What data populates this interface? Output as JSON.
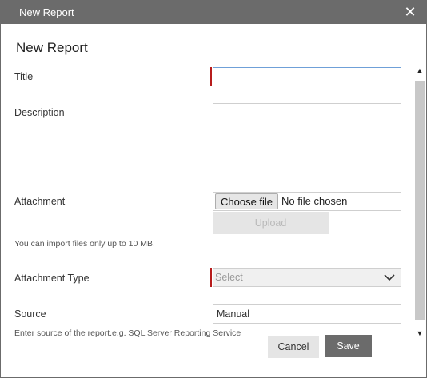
{
  "dialog": {
    "title": "New Report",
    "close_glyph": "✕",
    "heading": "New Report"
  },
  "form": {
    "title_label": "Title",
    "title_value": "",
    "description_label": "Description",
    "description_value": "",
    "attachment_label": "Attachment",
    "choose_file_label": "Choose file",
    "no_file_label": "No file chosen",
    "upload_label": "Upload",
    "import_hint": "You can import files only up to 10 MB.",
    "attachment_type_label": "Attachment Type",
    "attachment_type_value": "Select",
    "source_label": "Source",
    "source_value": "Manual",
    "source_hint": "Enter source of the report.e.g. SQL Server Reporting Service"
  },
  "buttons": {
    "cancel_label": "Cancel",
    "save_label": "Save"
  },
  "colors": {
    "titlebar": "#6b6b6b",
    "required_marker": "#b71c1c",
    "focus_border": "#6fa0d8",
    "save_button": "#6b6b6b"
  },
  "icons": {
    "close": "close-icon",
    "dropdown": "chevron-down-icon",
    "scroll_up": "scroll-up-arrow-icon",
    "scroll_down": "scroll-down-arrow-icon"
  }
}
